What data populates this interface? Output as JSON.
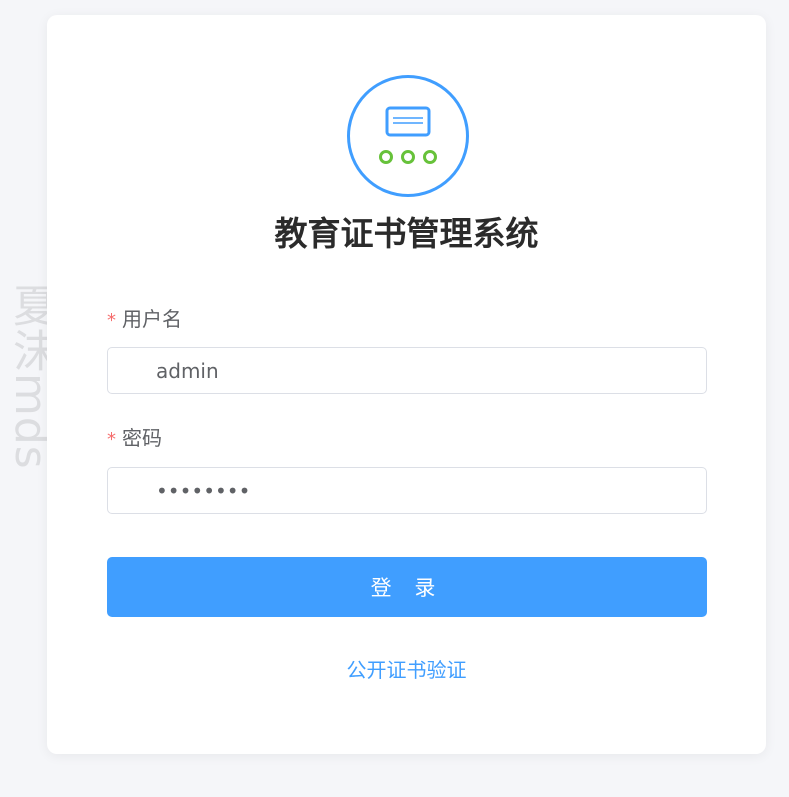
{
  "watermark": "夏沫mds",
  "app": {
    "title": "教育证书管理系统",
    "logo_icon": "certificate-icon"
  },
  "form": {
    "username": {
      "label": "用户名",
      "required_mark": "*",
      "value": "admin"
    },
    "password": {
      "label": "密码",
      "required_mark": "*",
      "value": "password"
    },
    "login_button": "登 录",
    "verify_link": "公开证书验证"
  },
  "colors": {
    "primary": "#409eff",
    "required": "#f56c6c",
    "logo_dots": "#67c23a",
    "background": "#f5f6f9"
  }
}
